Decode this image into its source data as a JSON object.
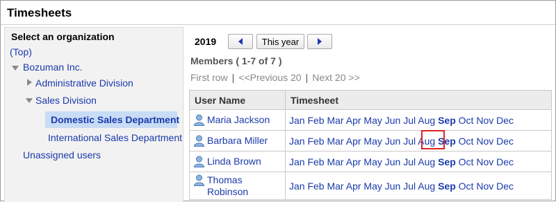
{
  "page": {
    "title": "Timesheets"
  },
  "left": {
    "heading": "Select an organization",
    "tree": [
      {
        "label": "(Top)"
      },
      {
        "label": "Bozuman Inc."
      },
      {
        "label": "Administrative Division"
      },
      {
        "label": "Sales Division"
      },
      {
        "label": "Domestic Sales Department",
        "selected": true
      },
      {
        "label": "International Sales Department"
      },
      {
        "label": "Unassigned users"
      }
    ]
  },
  "nav": {
    "year": "2019",
    "this_year_label": "This year"
  },
  "members": {
    "label": "Members ( 1-7 of 7 )",
    "first_row": "First row",
    "previous": "<<Previous 20",
    "next": "Next 20 >>",
    "separator": "|"
  },
  "table": {
    "headers": [
      "User Name",
      "Timesheet"
    ],
    "months": [
      "Jan",
      "Feb",
      "Mar",
      "Apr",
      "May",
      "Jun",
      "Jul",
      "Aug",
      "Sep",
      "Oct",
      "Nov",
      "Dec"
    ],
    "current_month": "Sep",
    "rows": [
      {
        "name": "Maria Jackson"
      },
      {
        "name": "Barbara Miller"
      },
      {
        "name": "Linda Brown"
      },
      {
        "name": "Thomas Robinson"
      }
    ]
  },
  "colors": {
    "link": "#1a3aaa",
    "selected_bg": "#c8dcf5",
    "highlight": "#e02020",
    "header_bg": "#ececec"
  }
}
